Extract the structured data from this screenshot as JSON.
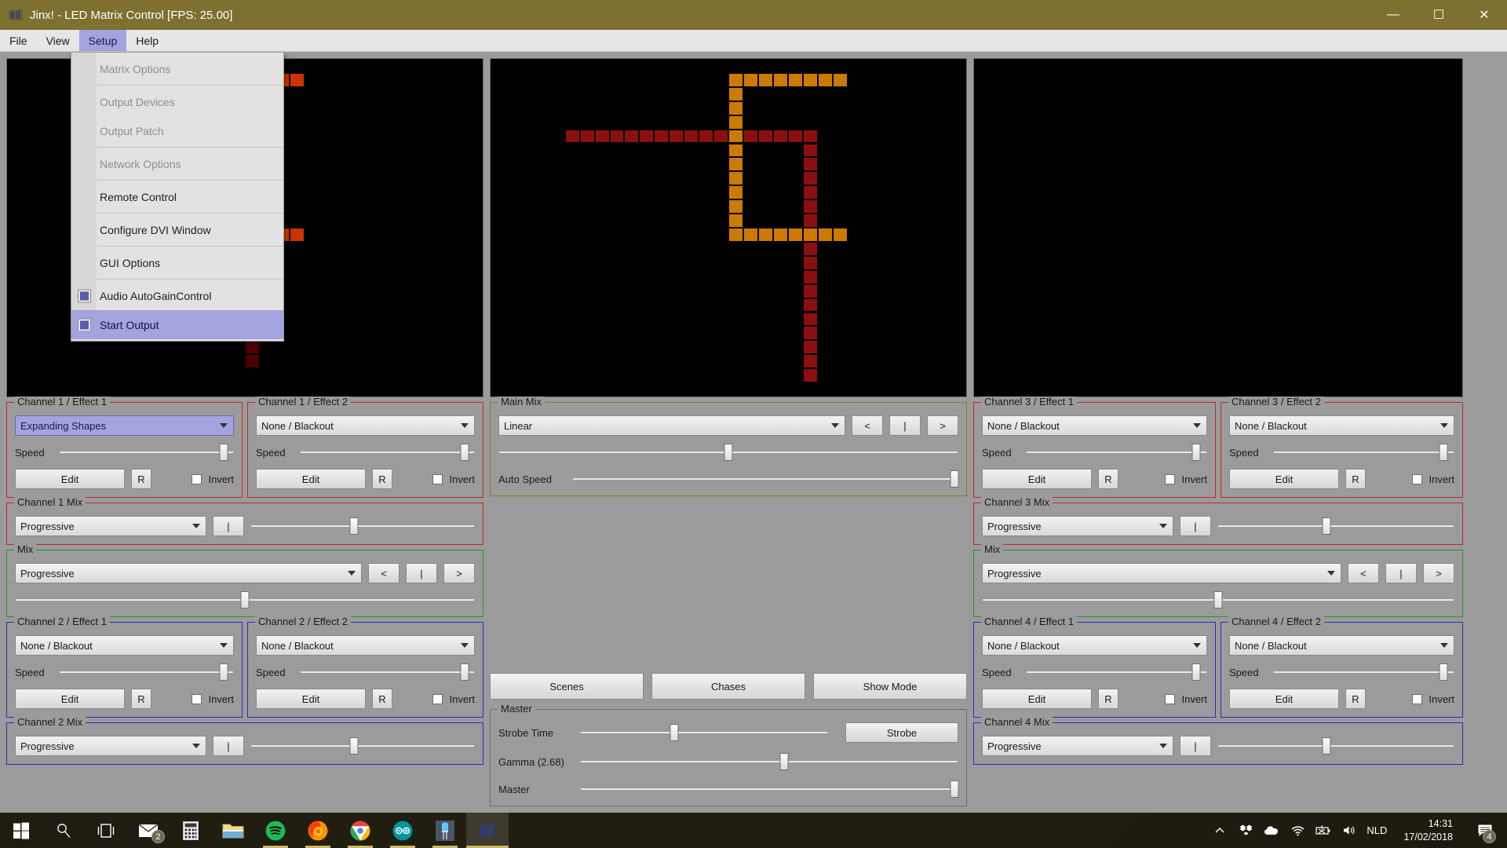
{
  "window": {
    "title": "Jinx! - LED Matrix Control [FPS: 25.00]",
    "app_icon": "jinx-icon",
    "minimize": "—",
    "maximize": "☐",
    "close": "✕"
  },
  "menubar": {
    "items": [
      {
        "label": "File",
        "active": false
      },
      {
        "label": "View",
        "active": false
      },
      {
        "label": "Setup",
        "active": true
      },
      {
        "label": "Help",
        "active": false
      }
    ]
  },
  "setup_menu": {
    "open": true,
    "items": [
      {
        "label": "Matrix Options",
        "enabled": false,
        "checkbox": null,
        "highlighted": false,
        "separator_after": true
      },
      {
        "label": "Output Devices",
        "enabled": false,
        "checkbox": null,
        "highlighted": false,
        "separator_after": false
      },
      {
        "label": "Output Patch",
        "enabled": false,
        "checkbox": null,
        "highlighted": false,
        "separator_after": true
      },
      {
        "label": "Network Options",
        "enabled": false,
        "checkbox": null,
        "highlighted": false,
        "separator_after": true
      },
      {
        "label": "Remote Control",
        "enabled": true,
        "checkbox": null,
        "highlighted": false,
        "separator_after": true
      },
      {
        "label": "Configure DVI Window",
        "enabled": true,
        "checkbox": null,
        "highlighted": false,
        "separator_after": true
      },
      {
        "label": "GUI Options",
        "enabled": true,
        "checkbox": null,
        "highlighted": false,
        "separator_after": true
      },
      {
        "label": "Audio AutoGainControl",
        "enabled": true,
        "checkbox": true,
        "highlighted": false,
        "separator_after": false
      },
      {
        "label": "Start Output",
        "enabled": true,
        "checkbox": true,
        "highlighted": true,
        "separator_after": false
      }
    ]
  },
  "previews": {
    "colors": {
      "bright": "#cc3300",
      "dim": "#4d0000",
      "bright_mid": "#cc7a00",
      "dim_mid": "#8b0f0f",
      "off": "#000000"
    },
    "grid": {
      "cols": 32,
      "rows": 24
    },
    "left": {
      "name": "preview-channel-left",
      "pixels": [
        {
          "c": 14,
          "r": 1,
          "w": 6,
          "h": 1,
          "tone": "bright"
        },
        {
          "c": 14,
          "r": 6,
          "w": 3,
          "h": 1,
          "tone": "dim"
        },
        {
          "c": 16,
          "r": 7,
          "w": 1,
          "h": 5,
          "tone": "dim"
        },
        {
          "c": 14,
          "r": 12,
          "w": 6,
          "h": 1,
          "tone": "bright"
        },
        {
          "c": 16,
          "r": 13,
          "w": 1,
          "h": 9,
          "tone": "dim"
        }
      ]
    },
    "middle": {
      "name": "preview-main-output",
      "pixels": [
        {
          "c": 16,
          "r": 1,
          "w": 8,
          "h": 1,
          "tone": "bright_mid"
        },
        {
          "c": 16,
          "r": 2,
          "w": 1,
          "h": 4,
          "tone": "bright_mid"
        },
        {
          "c": 5,
          "r": 5,
          "w": 11,
          "h": 1,
          "tone": "dim_mid"
        },
        {
          "c": 17,
          "r": 5,
          "w": 5,
          "h": 1,
          "tone": "dim_mid"
        },
        {
          "c": 16,
          "r": 6,
          "w": 1,
          "h": 6,
          "tone": "bright_mid"
        },
        {
          "c": 21,
          "r": 6,
          "w": 1,
          "h": 6,
          "tone": "dim_mid"
        },
        {
          "c": 16,
          "r": 12,
          "w": 8,
          "h": 1,
          "tone": "bright_mid"
        },
        {
          "c": 21,
          "r": 13,
          "w": 1,
          "h": 10,
          "tone": "dim_mid"
        }
      ]
    },
    "right": {
      "name": "preview-channel-right",
      "pixels": []
    }
  },
  "panels": {
    "ch1_effect1": {
      "title": "Channel 1 / Effect 1",
      "border": "#c02a2a",
      "effect": "Expanding Shapes",
      "effect_selected": true,
      "speed_label": "Speed",
      "speed_pct": 94,
      "edit_label": "Edit",
      "reset_label": "R",
      "invert_label": "Invert",
      "invert_checked": false
    },
    "ch1_effect2": {
      "title": "Channel 1 / Effect 2",
      "border": "#c02a2a",
      "effect": "None / Blackout",
      "effect_selected": false,
      "speed_label": "Speed",
      "speed_pct": 94,
      "edit_label": "Edit",
      "reset_label": "R",
      "invert_label": "Invert",
      "invert_checked": false
    },
    "ch1_mix": {
      "title": "Channel 1 Mix",
      "border": "#c02a2a",
      "mode": "Progressive",
      "center_label": "|",
      "fader_pct": 46
    },
    "mix_left": {
      "title": "Mix",
      "border": "#1f9b31",
      "mode": "Progressive",
      "prev_label": "<",
      "center_label": "|",
      "next_label": ">",
      "fader_pct": 50
    },
    "ch2_effect1": {
      "title": "Channel 2 / Effect 1",
      "border": "#2b2bbb",
      "effect": "None / Blackout",
      "effect_selected": false,
      "speed_label": "Speed",
      "speed_pct": 94,
      "edit_label": "Edit",
      "reset_label": "R",
      "invert_label": "Invert",
      "invert_checked": false
    },
    "ch2_effect2": {
      "title": "Channel 2 / Effect 2",
      "border": "#2b2bbb",
      "effect": "None / Blackout",
      "effect_selected": false,
      "speed_label": "Speed",
      "speed_pct": 94,
      "edit_label": "Edit",
      "reset_label": "R",
      "invert_label": "Invert",
      "invert_checked": false
    },
    "ch2_mix": {
      "title": "Channel 2 Mix",
      "border": "#2b2bbb",
      "mode": "Progressive",
      "center_label": "|",
      "fader_pct": 46
    },
    "main_mix": {
      "title": "Main Mix",
      "border": "#8a7a20",
      "mode": "Linear",
      "prev_label": "<",
      "center_label": "|",
      "next_label": ">",
      "crossfade_pct": 50,
      "auto_speed_label": "Auto Speed",
      "auto_speed_pct": 99
    },
    "scene_buttons": {
      "scenes": "Scenes",
      "chases": "Chases",
      "show_mode": "Show Mode"
    },
    "master": {
      "title": "Master",
      "border": "#6e6e6e",
      "strobe_time_label": "Strobe Time",
      "strobe_time_pct": 38,
      "strobe_button": "Strobe",
      "gamma_label": "Gamma (2.68)",
      "gamma_pct": 54,
      "master_label": "Master",
      "master_pct": 99
    },
    "ch3_effect1": {
      "title": "Channel 3 / Effect 1",
      "border": "#c02a2a",
      "effect": "None / Blackout",
      "effect_selected": false,
      "speed_label": "Speed",
      "speed_pct": 94,
      "edit_label": "Edit",
      "reset_label": "R",
      "invert_label": "Invert",
      "invert_checked": false
    },
    "ch3_effect2": {
      "title": "Channel 3 / Effect 2",
      "border": "#c02a2a",
      "effect": "None / Blackout",
      "effect_selected": false,
      "speed_label": "Speed",
      "speed_pct": 94,
      "edit_label": "Edit",
      "reset_label": "R",
      "invert_label": "Invert",
      "invert_checked": false
    },
    "ch3_mix": {
      "title": "Channel 3 Mix",
      "border": "#c02a2a",
      "mode": "Progressive",
      "center_label": "|",
      "fader_pct": 46
    },
    "mix_right": {
      "title": "Mix",
      "border": "#1f9b31",
      "mode": "Progressive",
      "prev_label": "<",
      "center_label": "|",
      "next_label": ">",
      "fader_pct": 50
    },
    "ch4_effect1": {
      "title": "Channel 4 / Effect 1",
      "border": "#2b2bbb",
      "effect": "None / Blackout",
      "effect_selected": false,
      "speed_label": "Speed",
      "speed_pct": 94,
      "edit_label": "Edit",
      "reset_label": "R",
      "invert_label": "Invert",
      "invert_checked": false
    },
    "ch4_effect2": {
      "title": "Channel 4 / Effect 2",
      "border": "#2b2bbb",
      "effect": "None / Blackout",
      "effect_selected": false,
      "speed_label": "Speed",
      "speed_pct": 94,
      "edit_label": "Edit",
      "reset_label": "R",
      "invert_label": "Invert",
      "invert_checked": false
    },
    "ch4_mix": {
      "title": "Channel 4 Mix",
      "border": "#2b2bbb",
      "mode": "Progressive",
      "center_label": "|",
      "fader_pct": 46
    }
  },
  "taskbar": {
    "items": [
      {
        "name": "start-button",
        "icon": "windows-logo-icon",
        "badge": null
      },
      {
        "name": "search-button",
        "icon": "search-icon",
        "badge": null
      },
      {
        "name": "task-view-button",
        "icon": "task-view-icon",
        "badge": null
      },
      {
        "name": "mail-app",
        "icon": "mail-icon",
        "badge": "2"
      },
      {
        "name": "calculator-app",
        "icon": "calculator-icon",
        "badge": null
      },
      {
        "name": "file-explorer-app",
        "icon": "folder-icon",
        "badge": null
      },
      {
        "name": "spotify-app",
        "icon": "spotify-icon",
        "badge": null
      },
      {
        "name": "firefox-app",
        "icon": "firefox-icon",
        "badge": null
      },
      {
        "name": "chrome-app",
        "icon": "chrome-icon",
        "badge": null
      },
      {
        "name": "arduino-app",
        "icon": "arduino-icon",
        "badge": null
      },
      {
        "name": "led-app",
        "icon": "led-icon",
        "badge": null
      },
      {
        "name": "jinx-app",
        "icon": "jinx-icon",
        "badge": null
      }
    ],
    "tray": {
      "show_hidden": "show-hidden-icons-icon",
      "icons": [
        "dropbox-icon",
        "onedrive-icon",
        "wifi-icon",
        "battery-icon",
        "volume-icon"
      ],
      "language": "NLD",
      "time": "14:31",
      "date": "17/02/2018",
      "notifications_badge": "4"
    }
  }
}
